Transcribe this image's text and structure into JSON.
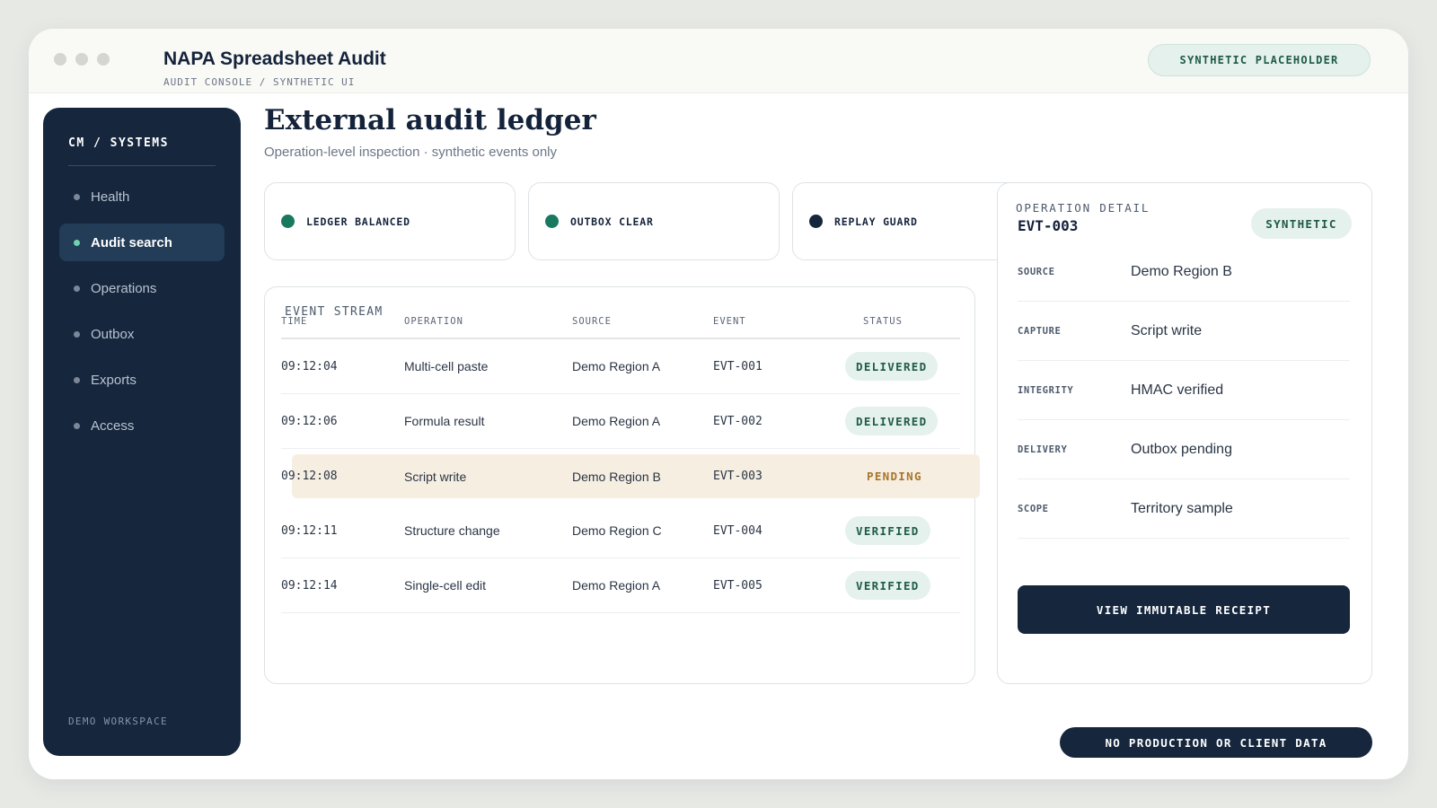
{
  "window": {
    "title": "NAPA Spreadsheet Audit",
    "breadcrumb": "AUDIT CONSOLE / SYNTHETIC UI",
    "badge": "SYNTHETIC PLACEHOLDER"
  },
  "sidebar": {
    "heading": "CM / SYSTEMS",
    "items": [
      {
        "label": "Health",
        "active": false
      },
      {
        "label": "Audit search",
        "active": true
      },
      {
        "label": "Operations",
        "active": false
      },
      {
        "label": "Outbox",
        "active": false
      },
      {
        "label": "Exports",
        "active": false
      },
      {
        "label": "Access",
        "active": false
      }
    ],
    "footer": "DEMO WORKSPACE"
  },
  "main": {
    "title": "External audit ledger",
    "subtitle": "Operation-level inspection · synthetic events only"
  },
  "status_cards": [
    {
      "label": "LEDGER BALANCED",
      "dot_color": "#17795e"
    },
    {
      "label": "OUTBOX CLEAR",
      "dot_color": "#17795e"
    },
    {
      "label": "REPLAY GUARD",
      "dot_color": "#15263d"
    }
  ],
  "event_stream": {
    "title": "EVENT STREAM",
    "columns": {
      "time": "TIME",
      "operation": "OPERATION",
      "source": "SOURCE",
      "event": "EVENT",
      "status": "STATUS"
    },
    "rows": [
      {
        "time": "09:12:04",
        "operation": "Multi-cell paste",
        "source": "Demo Region A",
        "event": "EVT-001",
        "status": "DELIVERED"
      },
      {
        "time": "09:12:06",
        "operation": "Formula result",
        "source": "Demo Region A",
        "event": "EVT-002",
        "status": "DELIVERED"
      },
      {
        "time": "09:12:08",
        "operation": "Script write",
        "source": "Demo Region B",
        "event": "EVT-003",
        "status": "PENDING"
      },
      {
        "time": "09:12:11",
        "operation": "Structure change",
        "source": "Demo Region C",
        "event": "EVT-004",
        "status": "VERIFIED"
      },
      {
        "time": "09:12:14",
        "operation": "Single-cell edit",
        "source": "Demo Region A",
        "event": "EVT-005",
        "status": "VERIFIED"
      }
    ]
  },
  "detail": {
    "label": "OPERATION DETAIL",
    "id": "EVT-003",
    "badge": "SYNTHETIC",
    "fields": [
      {
        "key": "SOURCE",
        "value": "Demo Region B"
      },
      {
        "key": "CAPTURE",
        "value": "Script write"
      },
      {
        "key": "INTEGRITY",
        "value": "HMAC verified"
      },
      {
        "key": "DELIVERY",
        "value": "Outbox pending"
      },
      {
        "key": "SCOPE",
        "value": "Territory sample"
      }
    ],
    "button": "VIEW IMMUTABLE RECEIPT"
  },
  "footer_badge": "NO PRODUCTION OR CLIENT DATA",
  "colors": {
    "navy": "#15263d",
    "accent_green": "#17795e",
    "pill_green_bg": "#e5f1ec",
    "pending_amber": "#a7752a",
    "highlight_row": "#f6eee1"
  }
}
